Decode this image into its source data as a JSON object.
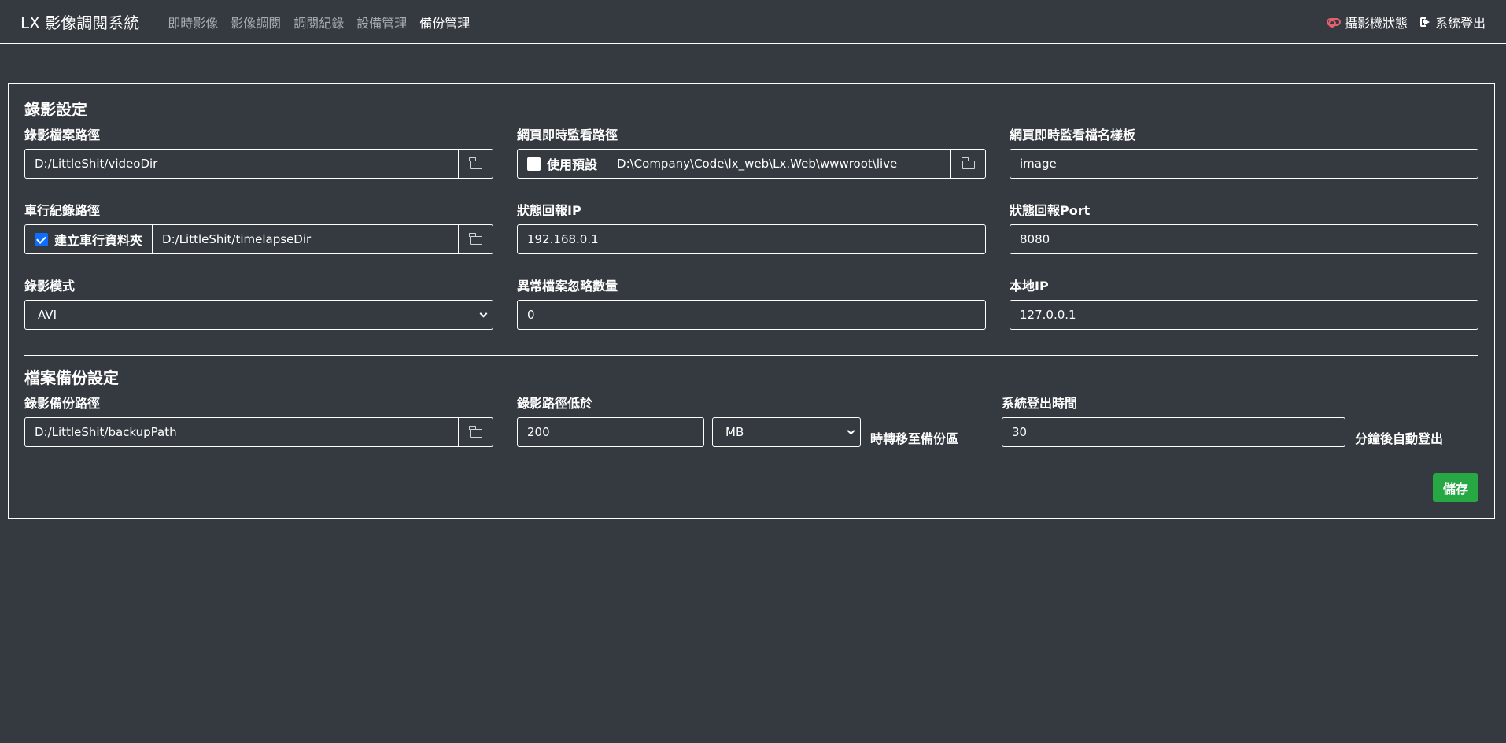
{
  "navbar": {
    "brand": "LX 影像調閱系統",
    "links": [
      "即時影像",
      "影像調閱",
      "調閱紀錄",
      "設備管理",
      "備份管理"
    ],
    "active_index": 4,
    "camera_status": "攝影機狀態",
    "logout": "系統登出",
    "camera_status_color": "#e4606d"
  },
  "recording": {
    "title": "錄影設定",
    "video_path": {
      "label": "錄影檔案路徑",
      "value": "D:/LittleShit/videoDir"
    },
    "live_path": {
      "label": "網頁即時監看路徑",
      "checkbox_label": "使用預設",
      "checked": false,
      "value": "D:\\Company\\Code\\lx_web\\Lx.Web\\wwwroot\\live"
    },
    "live_template": {
      "label": "網頁即時監看檔名樣板",
      "value": "image"
    },
    "timelapse_path": {
      "label": "車行紀錄路徑",
      "checkbox_label": "建立車行資料夾",
      "checked": true,
      "value": "D:/LittleShit/timelapseDir"
    },
    "status_ip": {
      "label": "狀態回報IP",
      "value": "192.168.0.1"
    },
    "status_port": {
      "label": "狀態回報Port",
      "value": "8080"
    },
    "record_mode": {
      "label": "錄影模式",
      "value": "AVI"
    },
    "ignore_count": {
      "label": "異常檔案忽略數量",
      "value": "0"
    },
    "local_ip": {
      "label": "本地IP",
      "value": "127.0.0.1"
    }
  },
  "backup": {
    "title": "檔案備份設定",
    "backup_path": {
      "label": "錄影備份路徑",
      "value": "D:/LittleShit/backupPath"
    },
    "threshold": {
      "label": "錄影路徑低於",
      "value": "200",
      "unit": "MB",
      "suffix": "時轉移至備份區"
    },
    "logout_time": {
      "label": "系統登出時間",
      "value": "30",
      "suffix": "分鐘後自動登出"
    },
    "save_label": "儲存",
    "save_color": "#28a745"
  },
  "icons": {
    "folder": "folder-icon",
    "camera_status": "toggle-icon",
    "logout": "sign-out-icon",
    "select": "chevron-down-icon"
  }
}
